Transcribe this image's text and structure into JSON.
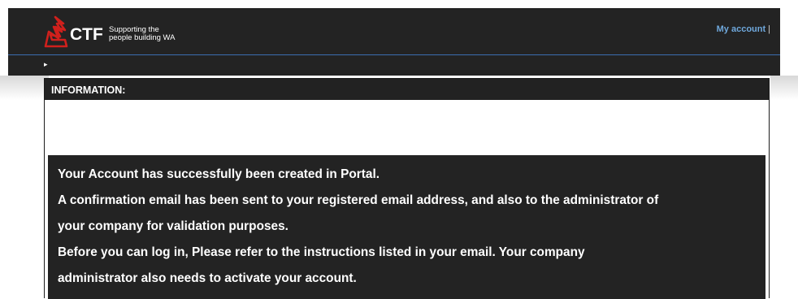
{
  "header": {
    "logo_text": "CTF",
    "tagline_line1": "Supporting the",
    "tagline_line2": "people building WA",
    "account_link": "My account",
    "account_separator": "|",
    "brand_red": "#d0201c"
  },
  "subnav": {
    "arrow_icon": "▸"
  },
  "panel": {
    "title": "INFORMATION:",
    "messages": [
      "Your Account has successfully been created in Portal.",
      "A confirmation email has been sent to your registered email address, and also to the administrator of",
      "your company for validation purposes.",
      "Before you can log in, Please refer to the instructions listed in your email. Your company",
      "administrator also needs to activate your account."
    ]
  }
}
